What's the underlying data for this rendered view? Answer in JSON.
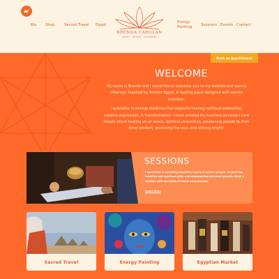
{
  "header": {
    "nav_left": [
      "Bio",
      "Shop",
      "Sacred Travel",
      "Egypt"
    ],
    "nav_right": [
      "Energy Painting",
      "Sessions",
      "Events",
      "Contact"
    ],
    "brand_name": "BRENDA CAROLAN",
    "brand_tagline": "ARTIST · HEALER · ALCHEMIST"
  },
  "hero": {
    "appointment_button": "Book an Appointment",
    "title": "WELCOME",
    "paragraph1": "My name is Brenda and I would like to welcome you to my website and sacred offerings. Inspired by Ancient Egypt. A healing place designed with sacred intention.",
    "paragraph2": "I specialize in energy medicine that supports healing, spiritual awakening, creative expression, & transformation. I have created my business because I care deeply about healing on all levels, spiritual connection, awakening people to their inner wisdom, accessing the soul, and shining bright!"
  },
  "sessions": {
    "title": "SESSIONS",
    "text": "I specialize in assisting empaths, highly sensitive people, awakening intuitive and spiritual gifts, and empowering personal growth. Book a session with me today to begin your journey.",
    "link": "Learn More"
  },
  "categories": [
    {
      "label": "Sacred Travel"
    },
    {
      "label": "Energy Painting"
    },
    {
      "label": "Egyptian Market"
    }
  ],
  "colors": {
    "orange": "#ff6a2b",
    "cream": "#fdf3e3",
    "gold": "#f5a623",
    "text_orange": "#e8572a"
  }
}
